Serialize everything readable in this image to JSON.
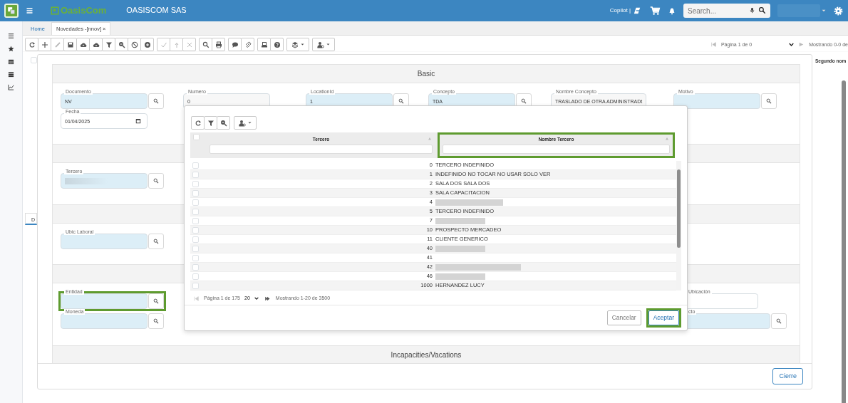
{
  "app": {
    "brand": "OasisCom",
    "company": "OASISCOM SAS",
    "copilot": "Copilot |",
    "search_placeholder": "Search..."
  },
  "tabs": [
    {
      "label": "Home",
      "selected": false
    },
    {
      "label": "Novedades -[nnov]",
      "selected": true,
      "close": "×"
    }
  ],
  "toolbar": [
    [
      {
        "disabled": false
      },
      {
        "disabled": false
      },
      {
        "disabled": true
      },
      {
        "disabled": false
      },
      {
        "disabled": false
      },
      {
        "disabled": false
      },
      {
        "disabled": false
      },
      {
        "disabled": false
      },
      {
        "disabled": false
      },
      {
        "disabled": false
      }
    ],
    [
      {
        "disabled": true
      },
      {
        "disabled": true
      },
      {
        "disabled": true
      }
    ],
    [
      {
        "disabled": false
      },
      {
        "disabled": false
      }
    ],
    [
      {
        "disabled": false
      },
      {
        "disabled": false
      }
    ],
    [
      {
        "disabled": false
      },
      {
        "disabled": false
      }
    ],
    [
      {
        "disabled": false
      }
    ],
    [
      {
        "disabled": false
      }
    ]
  ],
  "top_pager": {
    "page": "Página 1 de 0",
    "showing": "Mostrando 0-0 de"
  },
  "background_grid": {
    "column_header": "Segundo nom",
    "detail_tab": "D",
    "select_all_checked": false
  },
  "form": {
    "sections": [
      {
        "title": "Basic",
        "rows": [
          [
            {
              "label": "Documento",
              "value": "NV",
              "kind": "lookup",
              "highlighted": false
            },
            {
              "label": "Numero",
              "value": "0",
              "kind": "text",
              "highlighted": false
            },
            {
              "label": "LocationId",
              "value": "1",
              "kind": "lookup",
              "highlighted": false
            },
            {
              "label": "Concepto",
              "value": "TDA",
              "kind": "lookup",
              "highlighted": false
            },
            {
              "label": "Nombre Concepto",
              "value": "TRASLADO DE OTRA ADMINISTRADt",
              "kind": "text",
              "highlighted": false
            },
            {
              "label": "Motivo",
              "kind": "lookup",
              "highlighted": false
            }
          ],
          [
            {
              "label": "Fecha",
              "value": "01/04/2025",
              "kind": "date",
              "highlighted": false
            },
            null,
            null,
            null,
            null,
            null
          ]
        ]
      },
      {
        "rows": [
          [
            {
              "label": "Tercero",
              "kind": "lookup",
              "redacted": true,
              "highlighted": false
            },
            null,
            null,
            null,
            null,
            null
          ]
        ]
      },
      {
        "rows": [
          [
            {
              "label": "Ubic Laboral",
              "kind": "lookup",
              "highlighted": false
            },
            null,
            null,
            null,
            null,
            null
          ]
        ]
      },
      {
        "rows": [
          [
            {
              "label": "Entidad",
              "kind": "lookup",
              "highlighted": true
            },
            null,
            null,
            null,
            null,
            {
              "label": "Ubicación",
              "kind": "plain",
              "highlighted": false
            }
          ],
          [
            {
              "label": "Moneda",
              "kind": "lookup",
              "highlighted": false
            },
            null,
            null,
            null,
            null,
            {
              "label": "cto",
              "kind": "lookup",
              "highlighted": false
            }
          ]
        ]
      },
      {
        "title": "Incapacities/Vacations"
      }
    ],
    "close_button": "Cierre"
  },
  "dialog": {
    "select_all_checked": false,
    "columns": [
      {
        "label": "Tercero",
        "highlighted": false
      },
      {
        "label": "Nombre Tercero",
        "highlighted": true
      }
    ],
    "rows": [
      {
        "id": "0",
        "name": "TERCERO INDEFINIDO",
        "checked": false
      },
      {
        "id": "1",
        "name": "INDEFINIDO NO TOCAR NO USAR SOLO VER",
        "checked": false
      },
      {
        "id": "2",
        "name": "SALA DOS SALA DOS",
        "checked": false
      },
      {
        "id": "3",
        "name": "SALA CAPACITACION",
        "checked": false
      },
      {
        "id": "4",
        "redacted": true,
        "checked": false
      },
      {
        "id": "5",
        "name": "TERCERO INDEFINIDO",
        "checked": false
      },
      {
        "id": "7",
        "redacted": true,
        "checked": false
      },
      {
        "id": "10",
        "name": "PROSPECTO MERCADEO",
        "checked": false
      },
      {
        "id": "11",
        "name": "CLIENTE GENERICO",
        "checked": false
      },
      {
        "id": "40",
        "redacted": true,
        "checked": false
      },
      {
        "id": "41",
        "checked": false
      },
      {
        "id": "42",
        "redacted": true,
        "checked": false
      },
      {
        "id": "46",
        "redacted": true,
        "checked": false
      },
      {
        "id": "1000",
        "name": "HERNANDEZ LUCY",
        "checked": false
      }
    ],
    "pager": {
      "page": "Página 1 de 175",
      "page_size": "20",
      "showing": "Mostrando 1-20 de 3500"
    },
    "buttons": [
      {
        "label": "Cancelar",
        "kind": "secondary",
        "highlighted": false
      },
      {
        "label": "Aceptar",
        "kind": "primary",
        "highlighted": true
      }
    ]
  }
}
